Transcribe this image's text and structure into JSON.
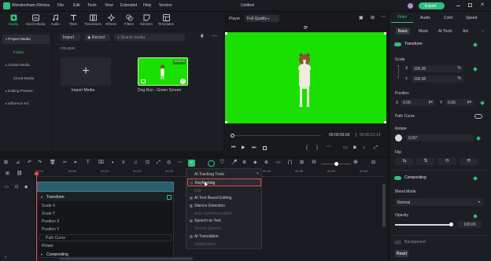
{
  "app": {
    "name": "Wondershare Filmora",
    "menus": [
      "File",
      "Edit",
      "Tools",
      "View",
      "Extended",
      "Help",
      "Version"
    ],
    "project_title": "Untitled",
    "export_label": "Export"
  },
  "toolbar": {
    "items": [
      "Media",
      "Stock Media",
      "Audio",
      "Titles",
      "Transitions",
      "Effects",
      "Filters",
      "Stickers",
      "Templates"
    ]
  },
  "left_nav": {
    "items": [
      "Project Media",
      "Folder",
      "Global Media",
      "Cloud Media",
      "Editing Presets",
      "Influence Kit"
    ]
  },
  "media": {
    "import_label": "Import",
    "record_label": "Record",
    "search_placeholder": "Search media",
    "folder_label": "FOLDER",
    "import_tile_label": "Import Media",
    "clip_label": "Dog Run - Green Screen",
    "clip_duration": "00:00:21"
  },
  "player": {
    "label": "Player",
    "quality": "Full Quality",
    "time_current": "00:00:00:00",
    "time_total": "00:00:21:14"
  },
  "right_panel": {
    "tabs": [
      "Video",
      "Audio",
      "Color",
      "Speed"
    ],
    "subtabs": [
      "Basic",
      "Mask",
      "AI Tools",
      "Ani"
    ],
    "transform_label": "Transform",
    "scale_label": "Scale",
    "scale_x_label": "X",
    "scale_y_label": "Y",
    "scale_x": "100.00",
    "scale_y": "100.00",
    "percent_unit": "%",
    "position_label": "Position",
    "pos_x_label": "X",
    "pos_y_label": "Y",
    "pos_x": "0.00",
    "pos_y": "0.00",
    "px_unit": "px",
    "path_curve_label": "Path Curve",
    "rotate_label": "Rotate",
    "rotate_value": "0.00°",
    "flip_label": "Flip",
    "compositing_label": "Compositing",
    "blend_mode_label": "Blend Mode",
    "blend_mode_value": "Normal",
    "opacity_label": "Opacity",
    "opacity_value": "100.00",
    "opacity_level": 1.0,
    "background_label": "Background",
    "reset_label": "Reset"
  },
  "timeline": {
    "ruler": [
      "00:00",
      "00:05",
      "00:10",
      "00:15",
      "00:20",
      "00:25",
      "00:30",
      "00:35",
      "00:40",
      "00:45"
    ],
    "prop_rows": [
      "Transform",
      "Scale X",
      "Scale Y",
      "Position X",
      "Position Y",
      "Path Curve",
      "Rotate",
      "Compositing"
    ]
  },
  "context_menu": {
    "items": [
      "AI Tracking Tools",
      "Keyframing",
      "Edit",
      "AI Text Based Editing",
      "Silence Detection",
      "Auto Synchronization",
      "Speech-to-Text",
      "Text-to-Speech",
      "AI Translation",
      "Stabilization"
    ],
    "enabled": [
      true,
      true,
      false,
      true,
      true,
      false,
      true,
      false,
      true,
      false
    ],
    "highlighted_index": 1
  },
  "colors": {
    "accent": "#2cc17f",
    "highlight_border": "#e0474c",
    "green_screen": "#19e000",
    "background": "#16171b"
  }
}
